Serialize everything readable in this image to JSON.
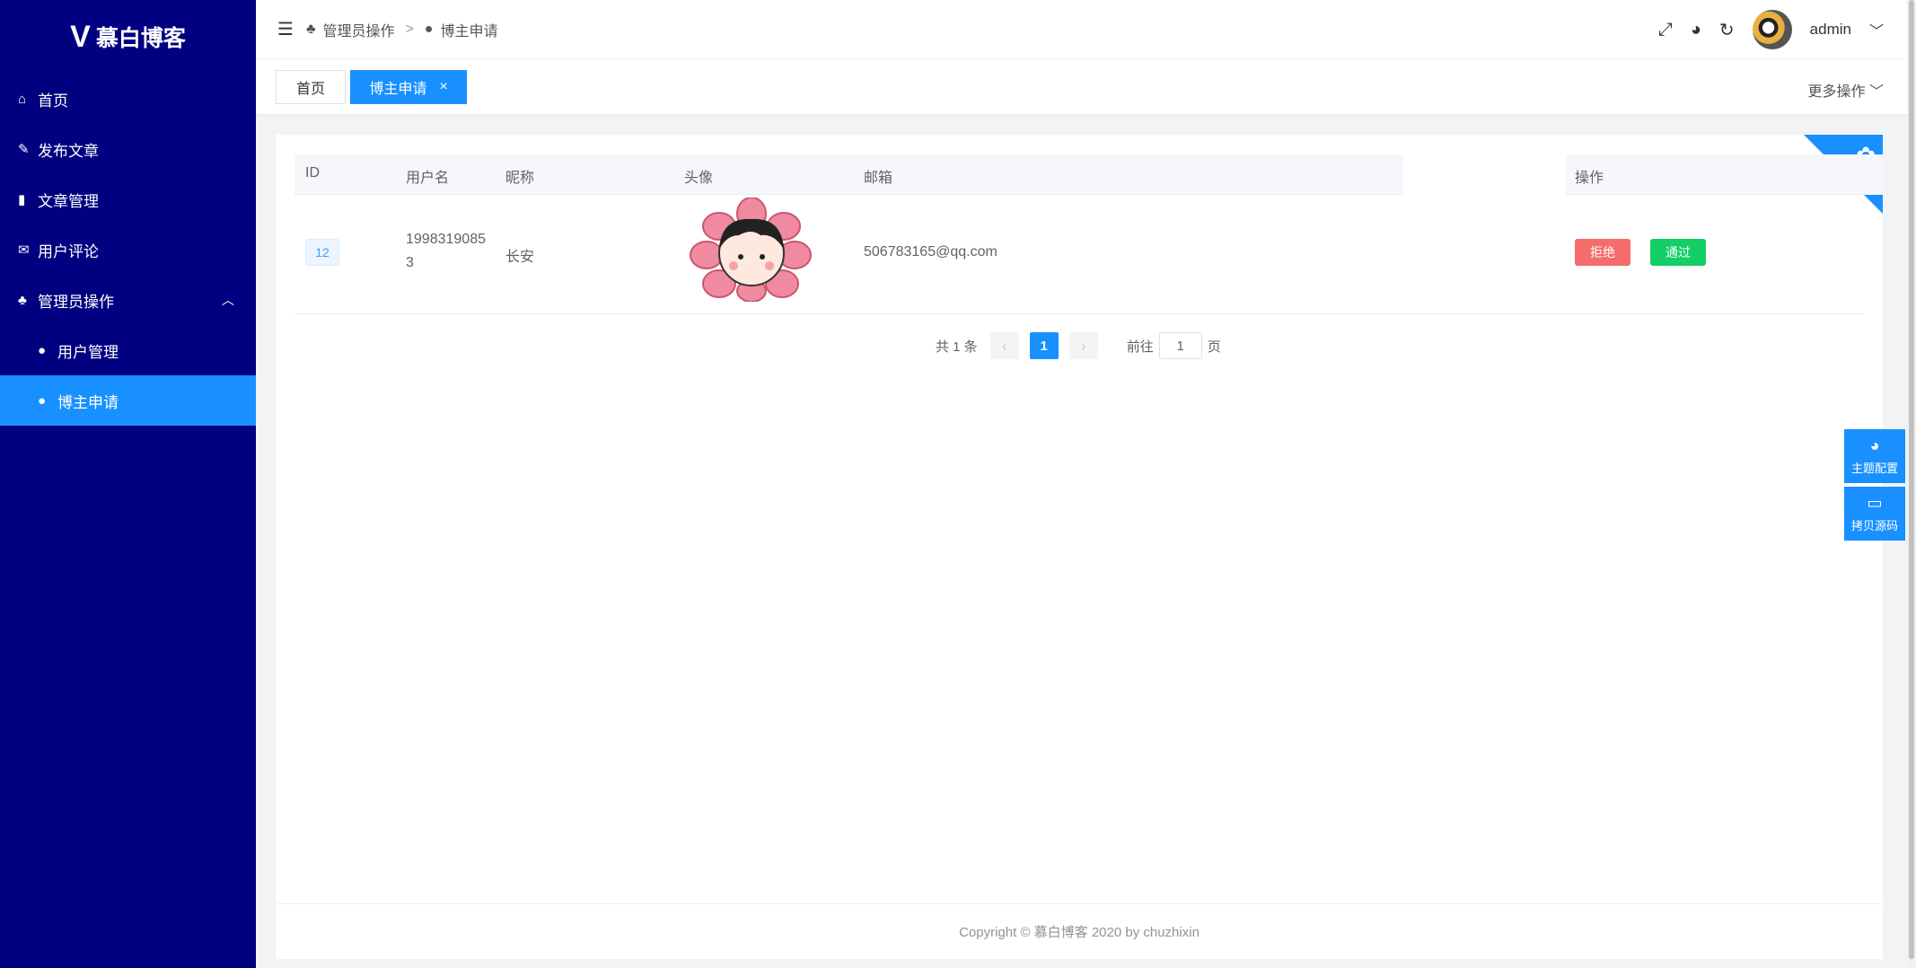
{
  "app": {
    "logo_mark": "V",
    "title": "慕白博客"
  },
  "sidebar": {
    "items": [
      {
        "icon": "home-icon",
        "glyph": "⌂",
        "label": "首页"
      },
      {
        "icon": "edit-icon",
        "glyph": "✎",
        "label": "发布文章"
      },
      {
        "icon": "book-icon",
        "glyph": "▮",
        "label": "文章管理"
      },
      {
        "icon": "comments-icon",
        "glyph": "✉",
        "label": "用户评论"
      },
      {
        "icon": "handshake-icon",
        "glyph": "♣",
        "label": "管理员操作"
      },
      {
        "icon": "user-icon",
        "glyph": "●",
        "label": "用户管理"
      },
      {
        "icon": "user-icon",
        "glyph": "●",
        "label": "博主申请"
      }
    ]
  },
  "header": {
    "breadcrumb": [
      "管理员操作",
      "博主申请"
    ],
    "separator": ">",
    "user": "admin"
  },
  "tabs": {
    "home": "首页",
    "active": "博主申请",
    "close": "×",
    "more": "更多操作"
  },
  "table": {
    "columns": [
      "ID",
      "用户名",
      "昵称",
      "头像",
      "邮箱",
      "操作"
    ],
    "rows": [
      {
        "id": "12",
        "username_1": "1998319085",
        "username_2": "3",
        "nickname": "长安",
        "email": "506783165@qq.com",
        "reject": "拒绝",
        "pass": "通过"
      }
    ]
  },
  "pagination": {
    "total_label": "共 1 条",
    "current": "1",
    "goto_label": "前往",
    "goto_value": "1",
    "page_label": "页"
  },
  "footer": {
    "text": "Copyright © 慕白博客 2020 by chuzhixin"
  },
  "float_panel": {
    "theme": "主题配置",
    "copy": "拷贝源码"
  },
  "colors": {
    "sidebar": "#000080",
    "accent": "#1890ff",
    "danger": "#f56c6c",
    "success": "#13ce66"
  }
}
